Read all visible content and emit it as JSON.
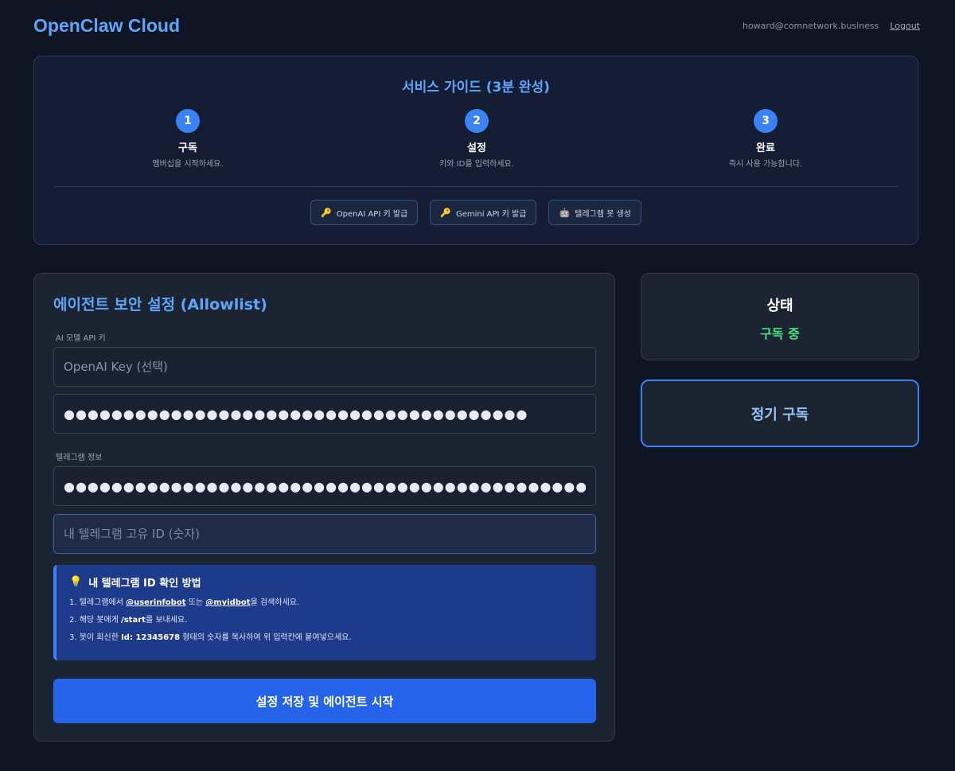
{
  "header": {
    "brand": "OpenClaw Cloud",
    "user_email": "howard@comnetwork.business",
    "logout_label": "Logout"
  },
  "guide": {
    "title": "서비스 가이드 (3분 완성)",
    "steps": [
      {
        "number": "1",
        "title": "구독",
        "desc": "멤버십을 시작하세요."
      },
      {
        "number": "2",
        "title": "설정",
        "desc": "키와 ID를 입력하세요."
      },
      {
        "number": "3",
        "title": "완료",
        "desc": "즉시 사용 가능합니다."
      }
    ],
    "links": [
      {
        "icon": "🔑",
        "label": "OpenAI API 키 발급"
      },
      {
        "icon": "🔑",
        "label": "Gemini API 키 발급"
      },
      {
        "icon": "🤖",
        "label": "텔레그램 봇 생성"
      }
    ]
  },
  "security": {
    "title": "에이전트 보안 설정 (Allowlist)",
    "api_label": "AI 모델 API 키",
    "openai_placeholder": "OpenAI Key (선택)",
    "gemini_value": "●●●●●●●●●●●●●●●●●●●●●●●●●●●●●●●●●●●●●●●",
    "telegram_label": "텔레그램 정보",
    "bot_token_value": "●●●●●●●●●●●●●●●●●●●●●●●●●●●●●●●●●●●●●●●●●●●●●●",
    "telegram_id_placeholder": "내 텔레그램 고유 ID (숫자)",
    "info": {
      "icon": "💡",
      "title": "내 텔레그램 ID 확인 방법",
      "line1_pre": "1. 텔레그램에서 ",
      "line1_bot1": "@userinfobot",
      "line1_mid": " 또는 ",
      "line1_bot2": "@myidbot",
      "line1_post": "을 검색하세요.",
      "line2_pre": "2. 해당 봇에게 ",
      "line2_cmd": "/start",
      "line2_post": "를 보내세요.",
      "line3_pre": "3. 봇이 회신한 ",
      "line3_id": "Id: 12345678",
      "line3_post": " 형태의 숫자를 복사하여 위 입력칸에 붙여넣으세요."
    },
    "submit_label": "설정 저장 및 에이전트 시작"
  },
  "status": {
    "title": "상태",
    "value": "구독 중",
    "value_color": "#4ade80"
  },
  "subscription": {
    "label": "정기 구독"
  },
  "colors": {
    "accent": "#60a5fa",
    "primary_button": "#2563eb",
    "background": "#0f1522"
  }
}
